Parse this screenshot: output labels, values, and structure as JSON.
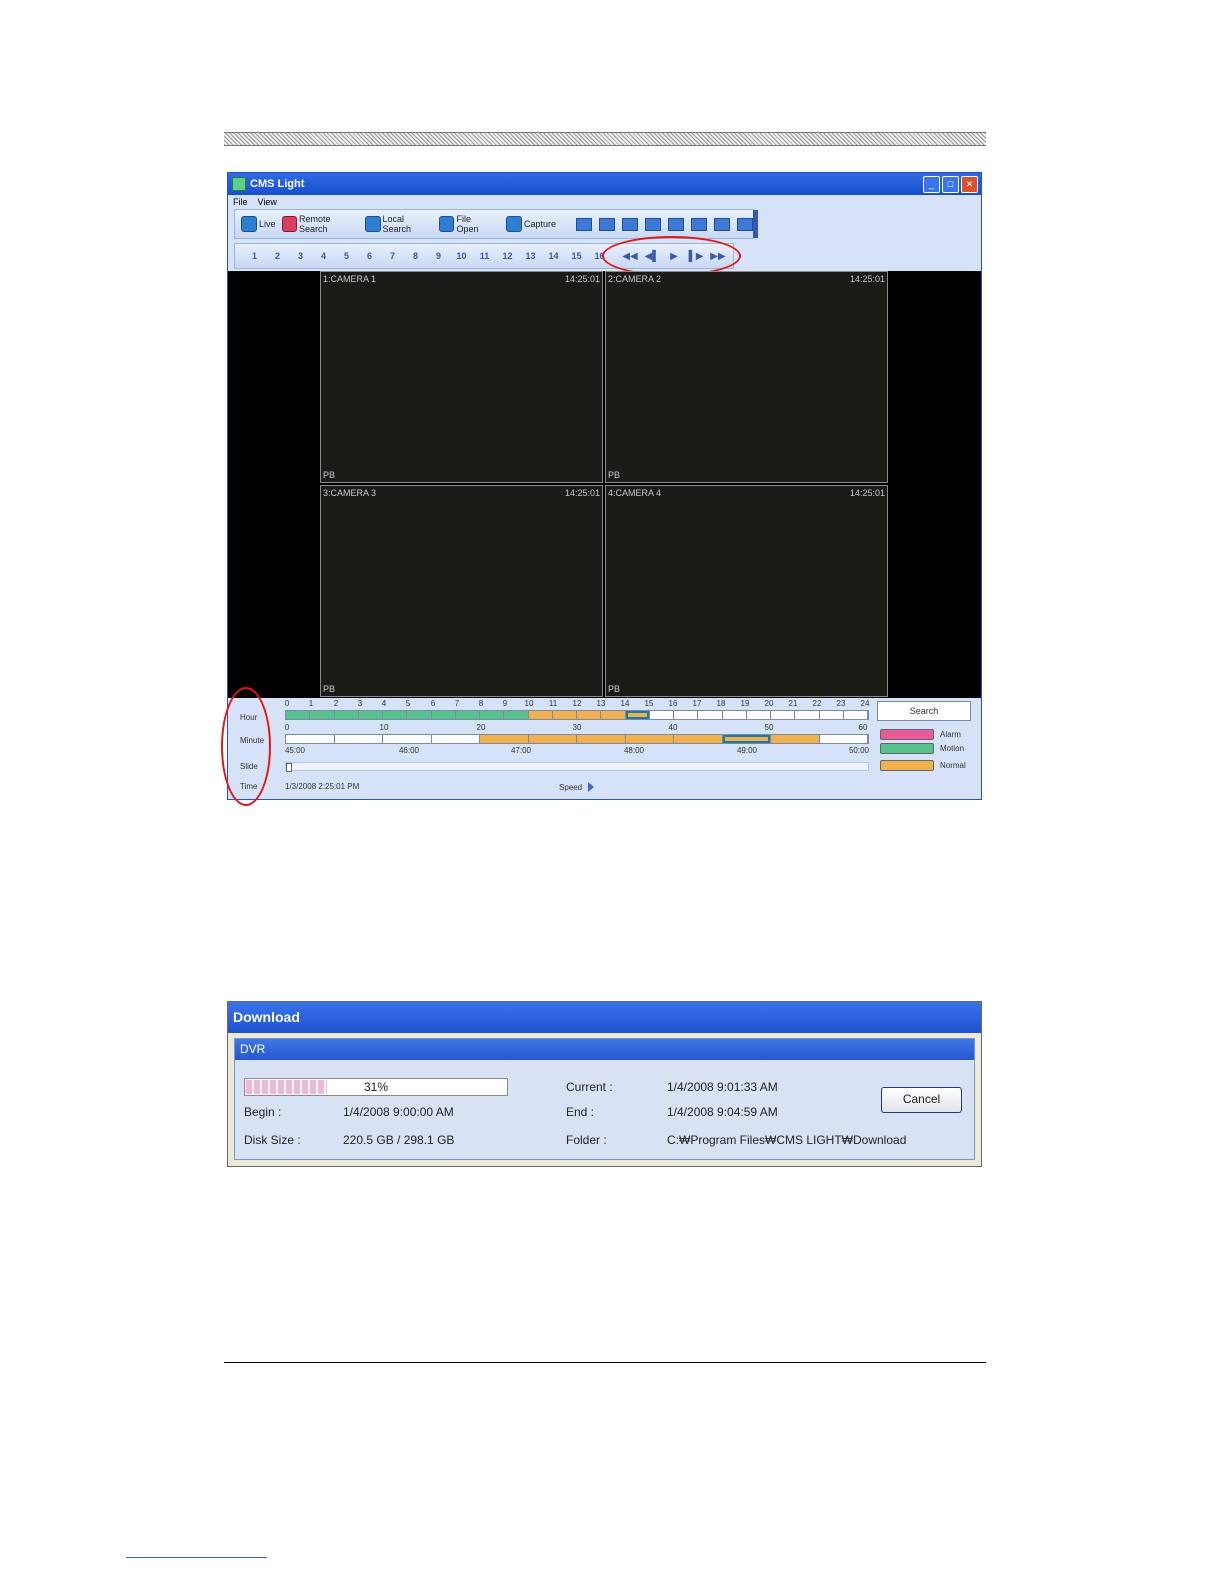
{
  "window": {
    "title": "CMS Light"
  },
  "menu": [
    "File",
    "View"
  ],
  "toolbar": {
    "buttons": [
      {
        "label": "Live",
        "icon": "live-icon"
      },
      {
        "label": "Remote Search",
        "icon": "remote-search-icon"
      },
      {
        "label": "Local Search",
        "icon": "local-search-icon"
      },
      {
        "label": "File Open",
        "icon": "file-open-icon"
      },
      {
        "label": "Capture",
        "icon": "capture-icon"
      }
    ]
  },
  "channels": [
    "1",
    "2",
    "3",
    "4",
    "5",
    "6",
    "7",
    "8",
    "9",
    "10",
    "11",
    "12",
    "13",
    "14",
    "15",
    "16"
  ],
  "playback_icons": [
    "rewind-icon",
    "step-back-icon",
    "play-icon",
    "step-forward-icon",
    "fast-forward-icon"
  ],
  "cameras": [
    {
      "label": "1:CAMERA 1",
      "time": "14:25:01",
      "mode": "PB"
    },
    {
      "label": "2:CAMERA 2",
      "time": "14:25:01",
      "mode": "PB"
    },
    {
      "label": "3:CAMERA 3",
      "time": "14:25:01",
      "mode": "PB"
    },
    {
      "label": "4:CAMERA 4",
      "time": "14:25:01",
      "mode": "PB"
    }
  ],
  "timeline": {
    "labels": {
      "hour": "Hour",
      "minute": "Minute",
      "slide": "Slide",
      "time": "Time"
    },
    "hour_ticks": [
      "0",
      "1",
      "2",
      "3",
      "4",
      "5",
      "6",
      "7",
      "8",
      "9",
      "10",
      "11",
      "12",
      "13",
      "14",
      "15",
      "16",
      "17",
      "18",
      "19",
      "20",
      "21",
      "22",
      "23",
      "24"
    ],
    "minute_ticks": [
      "0",
      "10",
      "20",
      "30",
      "40",
      "50",
      "60"
    ],
    "slide_ticks": [
      "45:00",
      "46:00",
      "47:00",
      "48:00",
      "49:00",
      "50:00"
    ],
    "time_value": "1/3/2008 2:25:01 PM",
    "speed_label": "Speed",
    "search_label": "Search",
    "legend": [
      {
        "label": "Alarm",
        "color": "#e85a9a"
      },
      {
        "label": "Motion",
        "color": "#57c28e"
      },
      {
        "label": "Normal",
        "color": "#f0b04e"
      }
    ]
  },
  "download": {
    "title": "Download",
    "section": "DVR",
    "progress_percent": 31,
    "progress_label": "31%",
    "begin_label": "Begin :",
    "begin_value": "1/4/2008 9:00:00 AM",
    "disk_label": "Disk Size :",
    "disk_value": "220.5 GB / 298.1 GB",
    "current_label": "Current :",
    "current_value": "1/4/2008 9:01:33 AM",
    "end_label": "End :",
    "end_value": "1/4/2008 9:04:59 AM",
    "folder_label": "Folder :",
    "folder_value": "C:₩Program Files₩CMS LIGHT₩Download",
    "cancel_label": "Cancel"
  }
}
